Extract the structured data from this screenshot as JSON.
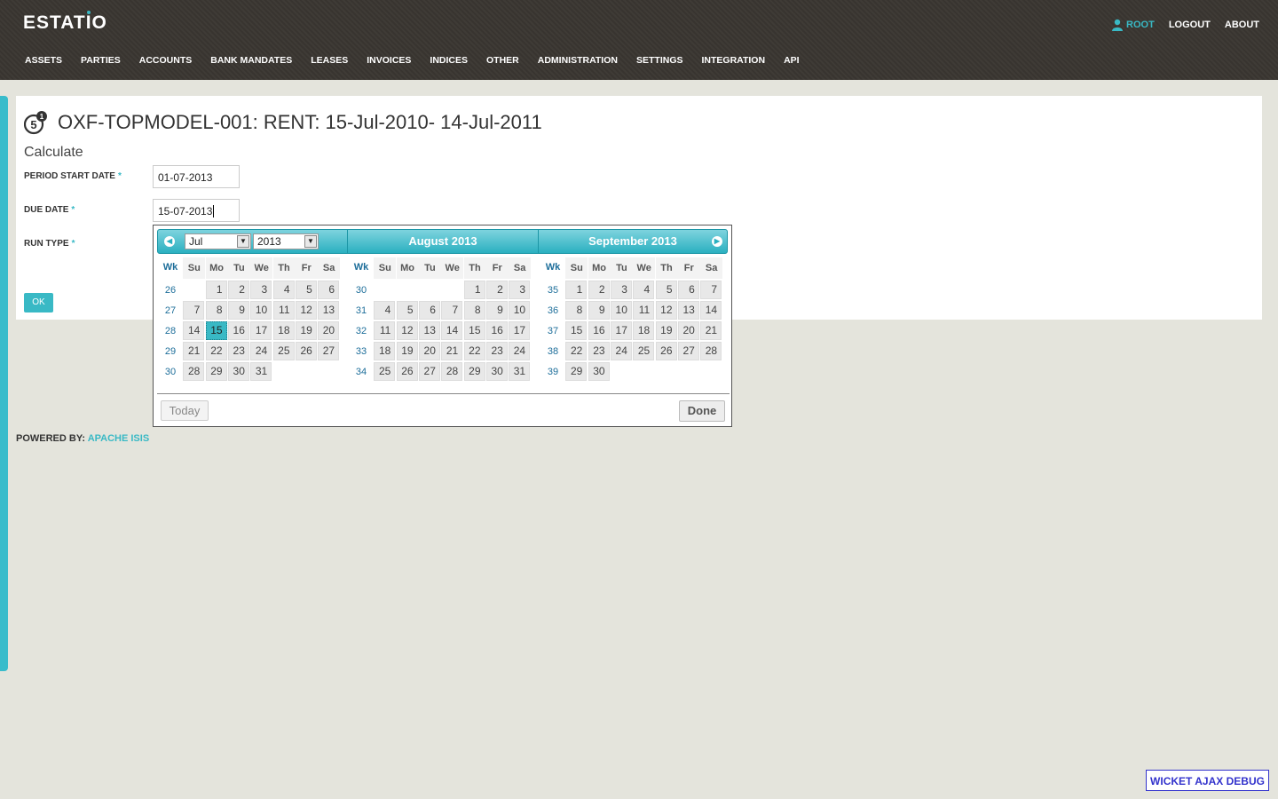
{
  "app": {
    "logo": "ESTATIO"
  },
  "toplinks": {
    "user": "ROOT",
    "logout": "LOGOUT",
    "about": "ABOUT"
  },
  "menu": [
    "ASSETS",
    "PARTIES",
    "ACCOUNTS",
    "BANK MANDATES",
    "LEASES",
    "INVOICES",
    "INDICES",
    "OTHER",
    "ADMINISTRATION",
    "SETTINGS",
    "INTEGRATION",
    "API"
  ],
  "page": {
    "badge_number": "5",
    "badge_count": "1",
    "title": "OXF-TOPMODEL-001: RENT: 15-Jul-2010- 14-Jul-2011",
    "subtitle": "Calculate",
    "fields": {
      "period_start_label": "PERIOD START DATE",
      "period_start_value": "01-07-2013",
      "due_date_label": "DUE DATE",
      "due_date_value": "15-07-2013",
      "run_type_label": "RUN TYPE",
      "required_marker": "*"
    },
    "ok_button": "OK"
  },
  "datepicker": {
    "month_select": "Jul",
    "year_select": "2013",
    "month2_title": "August 2013",
    "month3_title": "September 2013",
    "day_headers": [
      "Wk",
      "Su",
      "Mo",
      "Tu",
      "We",
      "Th",
      "Fr",
      "Sa"
    ],
    "today_button": "Today",
    "done_button": "Done",
    "selected": "15-07-2013",
    "months": [
      {
        "weeks": [
          {
            "wk": "26",
            "days": [
              "",
              "1",
              "2",
              "3",
              "4",
              "5",
              "6"
            ]
          },
          {
            "wk": "27",
            "days": [
              "7",
              "8",
              "9",
              "10",
              "11",
              "12",
              "13"
            ]
          },
          {
            "wk": "28",
            "days": [
              "14",
              "15",
              "16",
              "17",
              "18",
              "19",
              "20"
            ]
          },
          {
            "wk": "29",
            "days": [
              "21",
              "22",
              "23",
              "24",
              "25",
              "26",
              "27"
            ]
          },
          {
            "wk": "30",
            "days": [
              "28",
              "29",
              "30",
              "31",
              "",
              "",
              ""
            ]
          }
        ]
      },
      {
        "weeks": [
          {
            "wk": "30",
            "days": [
              "",
              "",
              "",
              "",
              "1",
              "2",
              "3"
            ]
          },
          {
            "wk": "31",
            "days": [
              "4",
              "5",
              "6",
              "7",
              "8",
              "9",
              "10"
            ]
          },
          {
            "wk": "32",
            "days": [
              "11",
              "12",
              "13",
              "14",
              "15",
              "16",
              "17"
            ]
          },
          {
            "wk": "33",
            "days": [
              "18",
              "19",
              "20",
              "21",
              "22",
              "23",
              "24"
            ]
          },
          {
            "wk": "34",
            "days": [
              "25",
              "26",
              "27",
              "28",
              "29",
              "30",
              "31"
            ]
          }
        ]
      },
      {
        "weeks": [
          {
            "wk": "35",
            "days": [
              "1",
              "2",
              "3",
              "4",
              "5",
              "6",
              "7"
            ]
          },
          {
            "wk": "36",
            "days": [
              "8",
              "9",
              "10",
              "11",
              "12",
              "13",
              "14"
            ]
          },
          {
            "wk": "37",
            "days": [
              "15",
              "16",
              "17",
              "18",
              "19",
              "20",
              "21"
            ]
          },
          {
            "wk": "38",
            "days": [
              "22",
              "23",
              "24",
              "25",
              "26",
              "27",
              "28"
            ]
          },
          {
            "wk": "39",
            "days": [
              "29",
              "30",
              "",
              "",
              "",
              "",
              ""
            ]
          }
        ]
      }
    ]
  },
  "footer": {
    "powered_by": "POWERED BY:",
    "powered_link": "APACHE ISIS"
  },
  "debug": {
    "label": "WICKET AJAX DEBUG"
  },
  "colors": {
    "accent": "#39b9c5",
    "topbar": "#3a3631",
    "background": "#e4e4dc"
  }
}
